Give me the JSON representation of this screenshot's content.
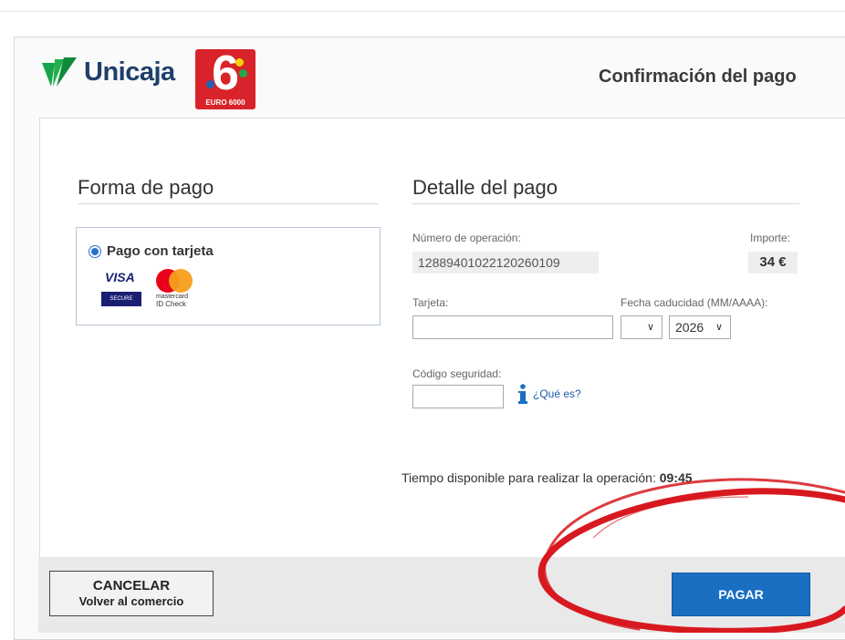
{
  "header": {
    "brand_name": "Unicaja",
    "network_logo_number": "6",
    "network_logo_text": "EURO 6000",
    "page_title": "Confirmación del pago"
  },
  "payment_method": {
    "title": "Forma de pago",
    "option_label": "Pago con tarjeta",
    "selected": true,
    "visa_word": "VISA",
    "visa_band": "SECURE",
    "mastercard_line1": "mastercard",
    "mastercard_line2": "ID Check"
  },
  "payment_detail": {
    "title": "Detalle del pago",
    "operation_label": "Número de operación:",
    "operation_number": "12889401022120260109",
    "amount_label": "Importe:",
    "amount": "34 €",
    "card_label": "Tarjeta:",
    "card_value": "",
    "expiry_label": "Fecha caducidad (MM/AAAA):",
    "expiry_month": "",
    "expiry_year": "2026",
    "security_label": "Código seguridad:",
    "security_value": "",
    "what_is_link": "¿Qué es?"
  },
  "timer": {
    "text": "Tiempo disponible para realizar la operación:",
    "value": "09:45"
  },
  "footer": {
    "cancel_line1": "CANCELAR",
    "cancel_line2": "Volver al comercio",
    "pay_label": "PAGAR"
  },
  "colors": {
    "brand_green": "#16a34a",
    "brand_blue": "#1f3f6b",
    "network_red": "#d8232a",
    "pay_button": "#1a6fc2",
    "annotation_red": "#d7191f"
  },
  "icons": [
    "unicaja-logo-icon",
    "radio-selected-icon",
    "visa-secure-icon",
    "mastercard-id-check-icon",
    "info-icon",
    "chevron-down-icon"
  ]
}
